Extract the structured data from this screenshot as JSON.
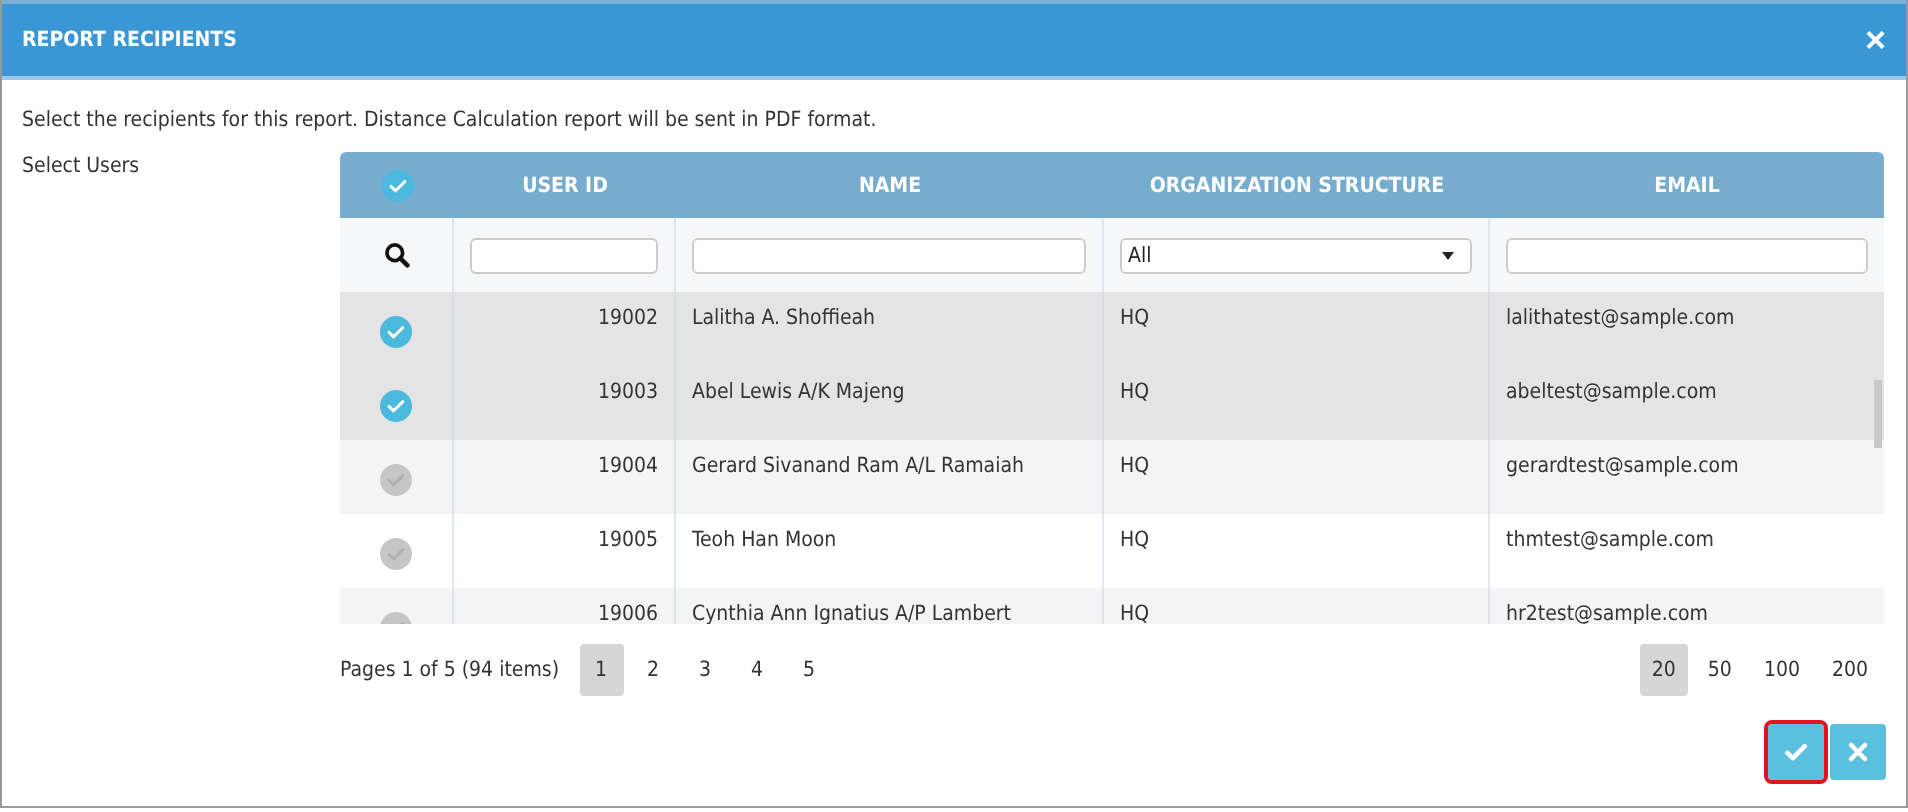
{
  "dialog": {
    "title": "REPORT RECIPIENTS",
    "close": "×"
  },
  "description": "Select the recipients for this report. Distance Calculation report will be sent in PDF format.",
  "users_label": "Select Users",
  "table": {
    "select_all_checked": true,
    "columns": [
      "USER ID",
      "NAME",
      "ORGANIZATION STRUCTURE",
      "EMAIL"
    ],
    "filters": [
      {
        "kind": "text"
      },
      {
        "kind": "text"
      },
      {
        "kind": "select",
        "value": "All"
      },
      {
        "kind": "text"
      }
    ],
    "rows": [
      {
        "selected": true,
        "user_id": "19002",
        "name": "Lalitha A. Shoffieah",
        "org": "HQ",
        "email": "lalithatest@sample.com"
      },
      {
        "selected": true,
        "user_id": "19003",
        "name": "Abel Lewis A/K Majeng",
        "org": "HQ",
        "email": "abeltest@sample.com"
      },
      {
        "selected": false,
        "user_id": "19004",
        "name": "Gerard Sivanand Ram A/L Ramaiah",
        "org": "HQ",
        "email": "gerardtest@sample.com"
      },
      {
        "selected": false,
        "user_id": "19005",
        "name": "Teoh Han Moon",
        "org": "HQ",
        "email": "thmtest@sample.com"
      },
      {
        "selected": false,
        "user_id": "19006",
        "name": "Cynthia Ann Ignatius A/P Lambert",
        "org": "HQ",
        "email": "hr2test@sample.com"
      }
    ]
  },
  "pager": {
    "summary": "Pages 1 of 5 (94 items)",
    "pages": [
      {
        "label": "1",
        "selected": true
      },
      {
        "label": "2",
        "selected": false
      },
      {
        "label": "3",
        "selected": false
      },
      {
        "label": "4",
        "selected": false
      },
      {
        "label": "5",
        "selected": false
      }
    ],
    "page_sizes": [
      {
        "label": "20",
        "selected": true
      },
      {
        "label": "50",
        "selected": false
      },
      {
        "label": "100",
        "selected": false
      },
      {
        "label": "200",
        "selected": false
      }
    ]
  },
  "buttons": [
    {
      "kind": "confirm",
      "highlighted": true
    },
    {
      "kind": "cancel",
      "highlighted": false
    }
  ]
}
